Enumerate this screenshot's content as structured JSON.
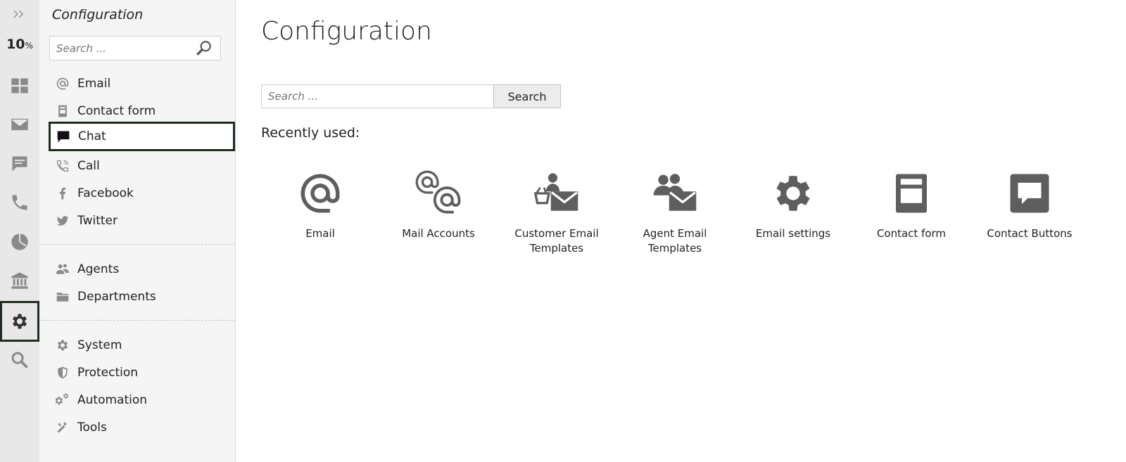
{
  "rail": {
    "percent": "10",
    "percent_unit": "%",
    "items": [
      {
        "name": "dashboard-icon"
      },
      {
        "name": "mail-icon"
      },
      {
        "name": "chat-icon"
      },
      {
        "name": "phone-icon"
      },
      {
        "name": "reports-icon"
      },
      {
        "name": "bank-icon"
      },
      {
        "name": "gear-icon",
        "active": true
      },
      {
        "name": "search-icon"
      }
    ]
  },
  "sidebar": {
    "title": "Configuration",
    "search_placeholder": "Search ...",
    "items": [
      {
        "label": "Email",
        "icon": "at-icon"
      },
      {
        "label": "Contact form",
        "icon": "form-icon"
      },
      {
        "label": "Chat",
        "icon": "chat-bubble-icon",
        "active": true
      },
      {
        "label": "Call",
        "icon": "phone-icon"
      },
      {
        "label": "Facebook",
        "icon": "facebook-icon"
      },
      {
        "label": "Twitter",
        "icon": "twitter-icon"
      },
      {
        "label": "Agents",
        "icon": "agents-icon"
      },
      {
        "label": "Departments",
        "icon": "folder-icon"
      },
      {
        "label": "System",
        "icon": "gear-icon"
      },
      {
        "label": "Protection",
        "icon": "shield-icon"
      },
      {
        "label": "Automation",
        "icon": "gears-icon"
      },
      {
        "label": "Tools",
        "icon": "tools-icon"
      }
    ]
  },
  "main": {
    "title": "Configuration",
    "search_placeholder": "Search ...",
    "search_button": "Search",
    "recently_used_label": "Recently used:",
    "tiles": [
      {
        "label": "Email",
        "icon": "at-icon"
      },
      {
        "label": "Mail Accounts",
        "icon": "double-at-icon"
      },
      {
        "label": "Customer Email Templates",
        "icon": "customer-email-icon"
      },
      {
        "label": "Agent Email Templates",
        "icon": "agent-email-icon"
      },
      {
        "label": "Email settings",
        "icon": "gear-icon"
      },
      {
        "label": "Contact form",
        "icon": "form-icon"
      },
      {
        "label": "Contact Buttons",
        "icon": "chat-bubble-icon"
      }
    ]
  },
  "colors": {
    "active_border": "#1d2e1d",
    "icon_gray": "#8a8a8a",
    "tile_icon": "#5e5e5e"
  }
}
